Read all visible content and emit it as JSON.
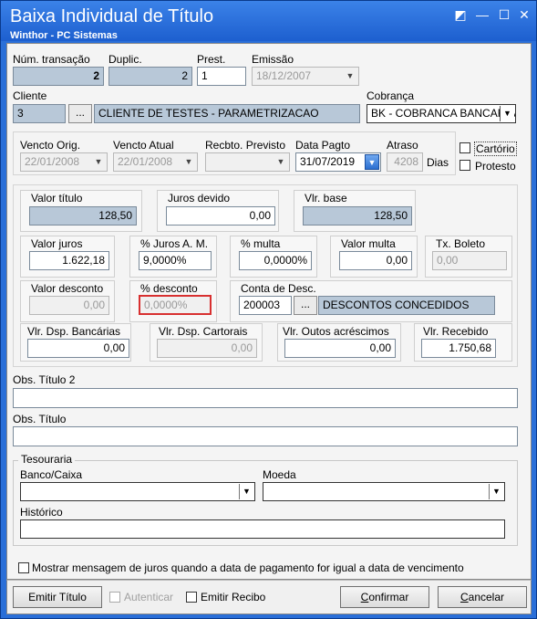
{
  "window": {
    "title": "Baixa Individual de Título",
    "subtitle": "Winthor - PC Sistemas",
    "restore_icon": "restore-icon",
    "minimize_glyph": "—",
    "maximize_glyph": "☐",
    "close_glyph": "✕",
    "restore_glyph": "◩"
  },
  "header": {
    "num_transacao_label": "Núm. transação",
    "num_transacao_value": "2",
    "duplic_label": "Duplic.",
    "duplic_value": "2",
    "prest_label": "Prest.",
    "prest_value": "1",
    "emissao_label": "Emissão",
    "emissao_value": "18/12/2007"
  },
  "cliente": {
    "label": "Cliente",
    "code": "3",
    "dots": "...",
    "name": "CLIENTE DE TESTES - PARAMETRIZACAO"
  },
  "cobranca": {
    "label": "Cobrança",
    "value": "BK - COBRANCA BANCARIA"
  },
  "dates": {
    "vencto_orig_label": "Vencto Orig.",
    "vencto_orig_value": "22/01/2008",
    "vencto_atual_label": "Vencto Atual",
    "vencto_atual_value": "22/01/2008",
    "recbto_previsto_label": "Recbto. Previsto",
    "recbto_previsto_value": "",
    "data_pagto_label": "Data Pagto",
    "data_pagto_value": "31/07/2019",
    "atraso_label": "Atraso",
    "atraso_value": "4208",
    "dias_label": "Dias",
    "cartorio_label": "Cartório",
    "protesto_label": "Protesto"
  },
  "valores": {
    "valor_titulo_label": "Valor título",
    "valor_titulo_value": "128,50",
    "juros_devido_label": "Juros devido",
    "juros_devido_value": "0,00",
    "vlr_base_label": "Vlr. base",
    "vlr_base_value": "128,50",
    "valor_juros_label": "Valor juros",
    "valor_juros_value": "1.622,18",
    "pct_juros_label": "% Juros A. M.",
    "pct_juros_value": "9,0000%",
    "pct_multa_label": "% multa",
    "pct_multa_value": "0,0000%",
    "valor_multa_label": "Valor multa",
    "valor_multa_value": "0,00",
    "tx_boleto_label": "Tx. Boleto",
    "tx_boleto_value": "0,00",
    "valor_desconto_label": "Valor desconto",
    "valor_desconto_value": "0,00",
    "pct_desconto_label": "% desconto",
    "pct_desconto_value": "0,0000%",
    "conta_desc_label": "Conta de Desc.",
    "conta_desc_code": "200003",
    "conta_desc_dots": "...",
    "conta_desc_name": "DESCONTOS CONCEDIDOS",
    "vlr_dsp_bancarias_label": "Vlr. Dsp. Bancárias",
    "vlr_dsp_bancarias_value": "0,00",
    "vlr_dsp_cartorais_label": "Vlr. Dsp. Cartorais",
    "vlr_dsp_cartorais_value": "0,00",
    "vlr_outos_label": "Vlr. Outos acréscimos",
    "vlr_outos_value": "0,00",
    "vlr_recebido_label": "Vlr. Recebido",
    "vlr_recebido_value": "1.750,68"
  },
  "obs": {
    "obs_titulo2_label": "Obs. Título 2",
    "obs_titulo2_value": "",
    "obs_titulo_label": "Obs. Título",
    "obs_titulo_value": ""
  },
  "tesouraria": {
    "label": "Tesouraria",
    "banco_caixa_label": "Banco/Caixa",
    "banco_caixa_value": "",
    "moeda_label": "Moeda",
    "moeda_value": "",
    "historico_label": "Histórico",
    "historico_value": ""
  },
  "mostrar_msg_label": "Mostrar mensagem de juros quando a data de pagamento for igual a data de vencimento",
  "footer": {
    "emitir_titulo": "Emitir Título",
    "autenticar": "Autenticar",
    "emitir_recibo": "Emitir Recibo",
    "confirmar_prefix": "C",
    "confirmar_rest": "onfirmar",
    "cancelar_prefix": "C",
    "cancelar_rest": "ancelar"
  },
  "icons": {
    "dropdown": "▼"
  }
}
